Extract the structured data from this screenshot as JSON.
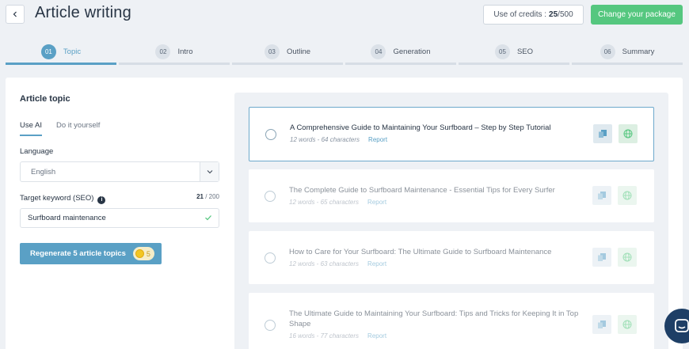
{
  "header": {
    "title": "Article writing",
    "credits_label": "Use of credits :",
    "credits_used": "25",
    "credits_total": "/500",
    "change_package_label": "Change your package"
  },
  "steps": [
    {
      "num": "01",
      "label": "Topic"
    },
    {
      "num": "02",
      "label": "Intro"
    },
    {
      "num": "03",
      "label": "Outline"
    },
    {
      "num": "04",
      "label": "Generation"
    },
    {
      "num": "05",
      "label": "SEO"
    },
    {
      "num": "06",
      "label": "Summary"
    }
  ],
  "active_step": "01",
  "form": {
    "section_title": "Article topic",
    "tabs": [
      "Use AI",
      "Do it yourself"
    ],
    "active_tab": "Use AI",
    "language_label": "Language",
    "language_value": "English",
    "keyword_label": "Target keyword (SEO)",
    "keyword_count": "21",
    "keyword_max": "/ 200",
    "keyword_value": "Surfboard maintenance",
    "regenerate_label": "Regenerate 5 article topics",
    "regenerate_cost": "5"
  },
  "topics": [
    {
      "title": "A Comprehensive Guide to Maintaining Your Surfboard – Step by Step Tutorial",
      "meta": "12 words - 64 characters",
      "report": "Report"
    },
    {
      "title": "The Complete Guide to Surfboard Maintenance - Essential Tips for Every Surfer",
      "meta": "12 words - 65 characters",
      "report": "Report"
    },
    {
      "title": "How to Care for Your Surfboard: The Ultimate Guide to Surfboard Maintenance",
      "meta": "12 words - 63 characters",
      "report": "Report"
    },
    {
      "title": "The Ultimate Guide to Maintaining Your Surfboard: Tips and Tricks for Keeping It in Top Shape",
      "meta": "16 words - 77 characters",
      "report": "Report"
    }
  ],
  "colors": {
    "accent": "#5aa0c5",
    "success": "#55c77f",
    "chat": "#1e3f66"
  }
}
